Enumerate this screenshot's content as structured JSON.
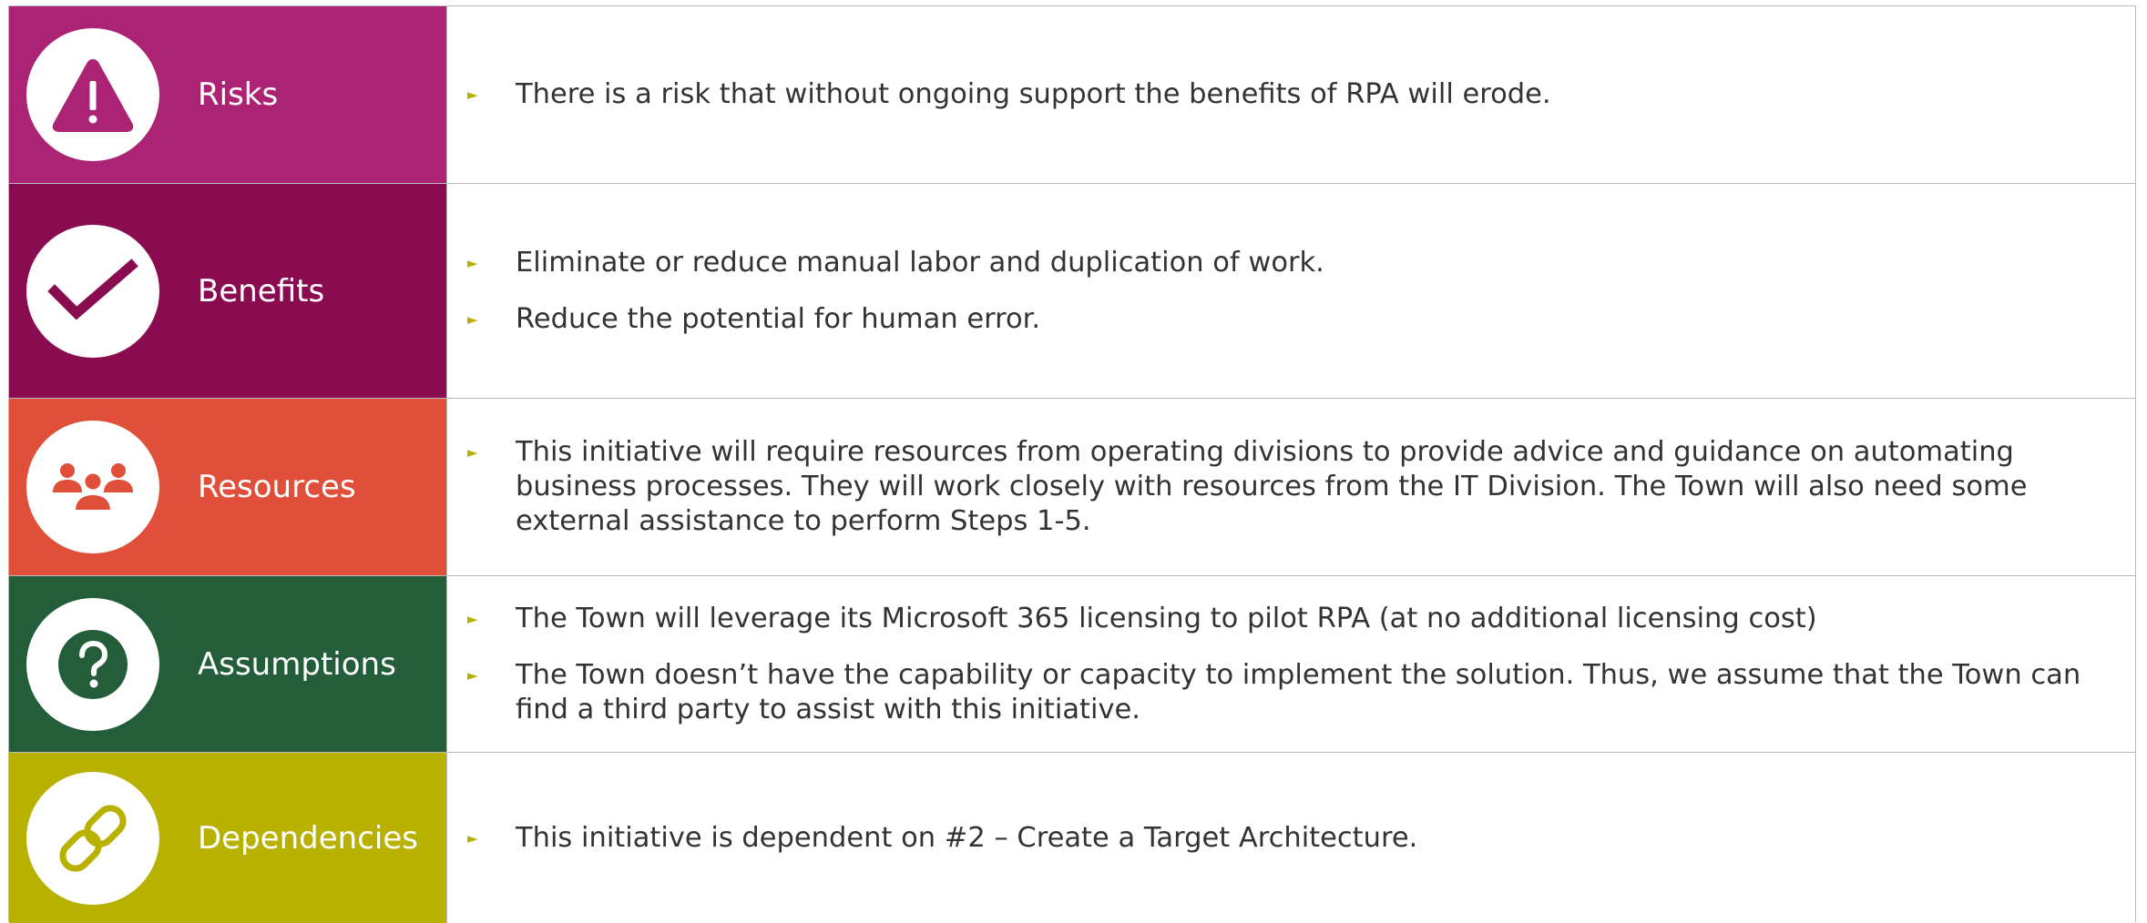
{
  "colors": {
    "risks": "#ad2374",
    "benefits": "#890c51",
    "resources": "#e04f39",
    "assumptions": "#245d3a",
    "dependencies": "#b8b100",
    "bullet": "#b7b000",
    "text": "#333333",
    "border": "#b9b9b9"
  },
  "bullet_glyph": "►",
  "rows": [
    {
      "label": "Risks",
      "icon": "warning-icon",
      "bullets": [
        "There is a risk that without ongoing support the benefits of RPA will erode."
      ]
    },
    {
      "label": "Benefits",
      "icon": "checkmark-icon",
      "bullets": [
        "Eliminate or reduce manual labor and duplication of work.",
        "Reduce the potential for human error."
      ]
    },
    {
      "label": "Resources",
      "icon": "people-group-icon",
      "bullets": [
        "This initiative will require resources from operating divisions to provide advice and guidance on automating business processes. They will work closely with resources from the IT Division. The Town will also need some external assistance to perform Steps 1-5."
      ]
    },
    {
      "label": "Assumptions",
      "icon": "question-icon",
      "bullets": [
        "The Town will leverage its Microsoft 365 licensing to pilot RPA (at no additional licensing cost)",
        "The Town doesn’t have the capability or capacity to implement the solution. Thus, we assume that the Town can find a third party to assist with this initiative."
      ]
    },
    {
      "label": "Dependencies",
      "icon": "chain-link-icon",
      "bullets": [
        "This initiative is dependent on #2 – Create a Target Architecture."
      ]
    }
  ]
}
